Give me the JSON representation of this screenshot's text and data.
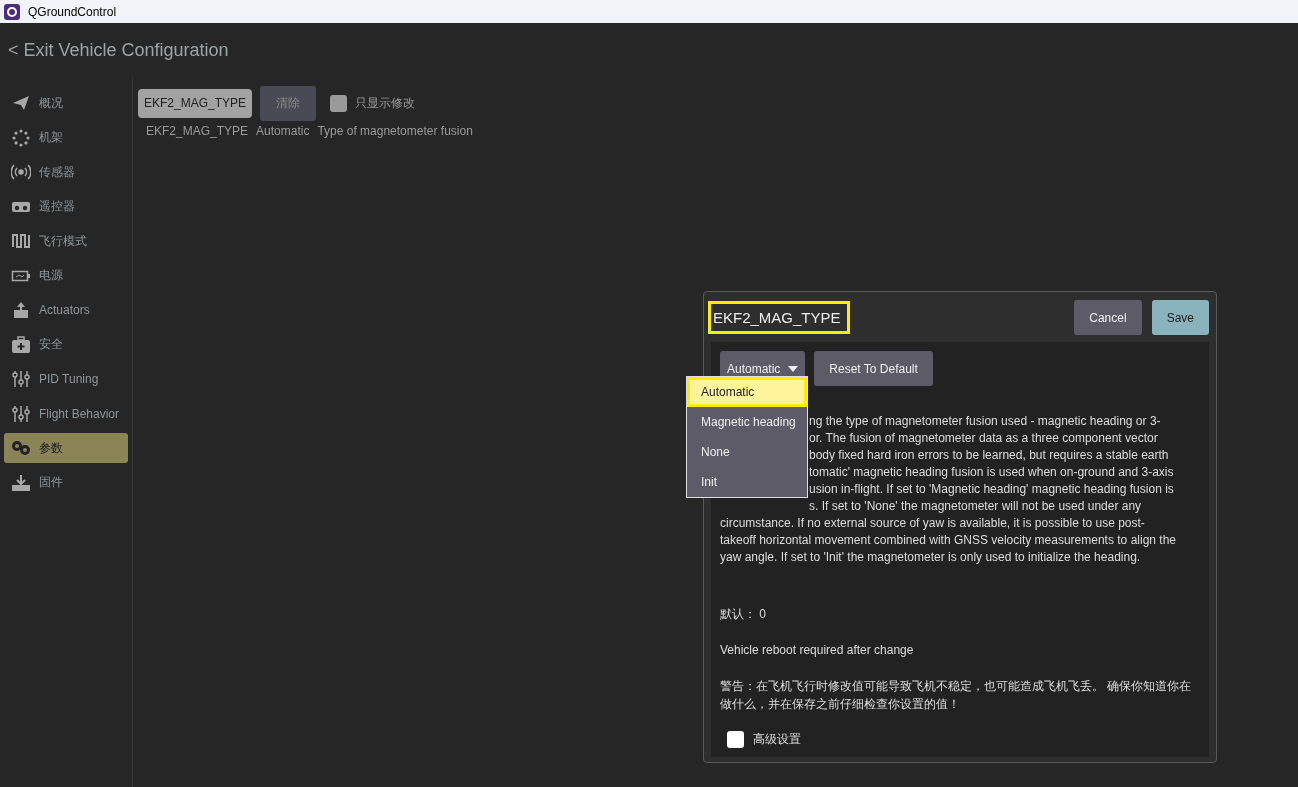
{
  "window": {
    "title": "QGroundControl"
  },
  "header": {
    "back_label": "< Exit Vehicle Configuration"
  },
  "sidebar": {
    "items": [
      {
        "label": "概况",
        "kind": "plane",
        "selected": false
      },
      {
        "label": "机架",
        "kind": "frame",
        "selected": false
      },
      {
        "label": "传感器",
        "kind": "sensor",
        "selected": false
      },
      {
        "label": "遥控器",
        "kind": "remote",
        "selected": false
      },
      {
        "label": "飞行模式",
        "kind": "wave",
        "selected": false
      },
      {
        "label": "电源",
        "kind": "battery",
        "selected": false
      },
      {
        "label": "Actuators",
        "kind": "actuator",
        "selected": false
      },
      {
        "label": "安全",
        "kind": "medkit",
        "selected": false
      },
      {
        "label": "PID Tuning",
        "kind": "sliders",
        "selected": false
      },
      {
        "label": "Flight Behavior",
        "kind": "sliders",
        "selected": false
      },
      {
        "label": "参数",
        "kind": "params",
        "selected": true
      },
      {
        "label": "固件",
        "kind": "firmware",
        "selected": false
      }
    ]
  },
  "toolbar": {
    "search_value": "EKF2_MAG_TYPE",
    "clear_label": "清除",
    "only_modified": {
      "label": "只显示修改",
      "checked": false
    }
  },
  "param_rows": [
    {
      "name": "EKF2_MAG_TYPE",
      "value": "Automatic",
      "description": "Type of magnetometer fusion"
    }
  ],
  "dialog": {
    "title": "EKF2_MAG_TYPE",
    "title_highlighted": true,
    "cancel_label": "Cancel",
    "save_label": "Save",
    "combo_value": "Automatic",
    "reset_label": "Reset To Default",
    "options": [
      {
        "label": "Automatic",
        "selected": true,
        "highlighted": true
      },
      {
        "label": "Magnetic heading",
        "selected": false,
        "highlighted": false
      },
      {
        "label": "None",
        "selected": false,
        "highlighted": false
      },
      {
        "label": "Init",
        "selected": false,
        "highlighted": false
      }
    ],
    "description_lines": [
      {
        "kind": "partial",
        "text": "ng the type of magnetometer fusion used - magnetic heading or 3-"
      },
      {
        "kind": "partial",
        "text": "or. The fusion of magnetometer data as a three component vector"
      },
      {
        "kind": "partial",
        "text": "body fixed hard iron errors to be learned, but requires a stable earth"
      },
      {
        "kind": "partial",
        "text": "tomatic' magnetic heading fusion is used when on-ground and 3-axis"
      },
      {
        "kind": "partial",
        "text": "usion in-flight. If set to 'Magnetic heading' magnetic heading fusion is"
      },
      {
        "kind": "partial",
        "text": "s. If set to 'None' the magnetometer will not be used under any"
      },
      {
        "kind": "full",
        "text": "circumstance. If no external source of yaw is available, it is possible to use post-"
      },
      {
        "kind": "full",
        "text": "takeoff horizontal movement combined with GNSS velocity measurements to align the"
      },
      {
        "kind": "full",
        "text": "yaw angle. If set to 'Init' the magnetometer is only used to initialize the heading."
      }
    ],
    "default_text": "默认： 0",
    "reboot_note": "Vehicle reboot required after change",
    "warning": "警告：在飞机飞行时修改值可能导致飞机不稳定，也可能造成飞机飞丢。 确保你知道你在做什么，并在保存之前仔细检查你设置的值！",
    "advanced": {
      "label": "高级设置",
      "checked": false
    }
  }
}
